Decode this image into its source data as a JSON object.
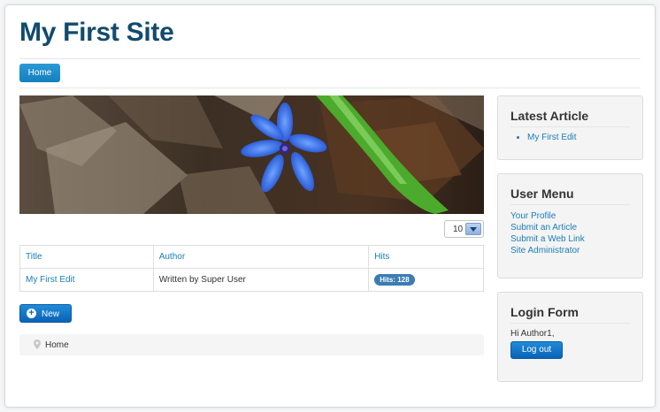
{
  "site": {
    "title": "My First Site"
  },
  "nav": {
    "home_label": "Home"
  },
  "list": {
    "limit_value": "10",
    "columns": [
      "Title",
      "Author",
      "Hits"
    ],
    "rows": [
      {
        "title": "My First Edit",
        "author": "Written by Super User",
        "hits": "Hits: 128"
      }
    ]
  },
  "toolbar": {
    "new_label": "New"
  },
  "breadcrumb": {
    "home_label": "Home"
  },
  "sidebar": {
    "latest_article": {
      "heading": "Latest Article",
      "items": [
        "My First Edit"
      ]
    },
    "user_menu": {
      "heading": "User Menu",
      "items": [
        "Your Profile",
        "Submit an Article",
        "Submit a Web Link",
        "Site Administrator"
      ]
    },
    "login_form": {
      "heading": "Login Form",
      "greeting": "Hi Author1,",
      "logout_label": "Log out"
    }
  },
  "colors": {
    "brand": "#124b6e",
    "link": "#1a7db8",
    "button": "#1e8fcc",
    "badge": "#3b7cb3"
  },
  "icons": {
    "new": "plus-circle-icon",
    "breadcrumb": "location-pin-icon",
    "select": "chevron-down-icon"
  }
}
